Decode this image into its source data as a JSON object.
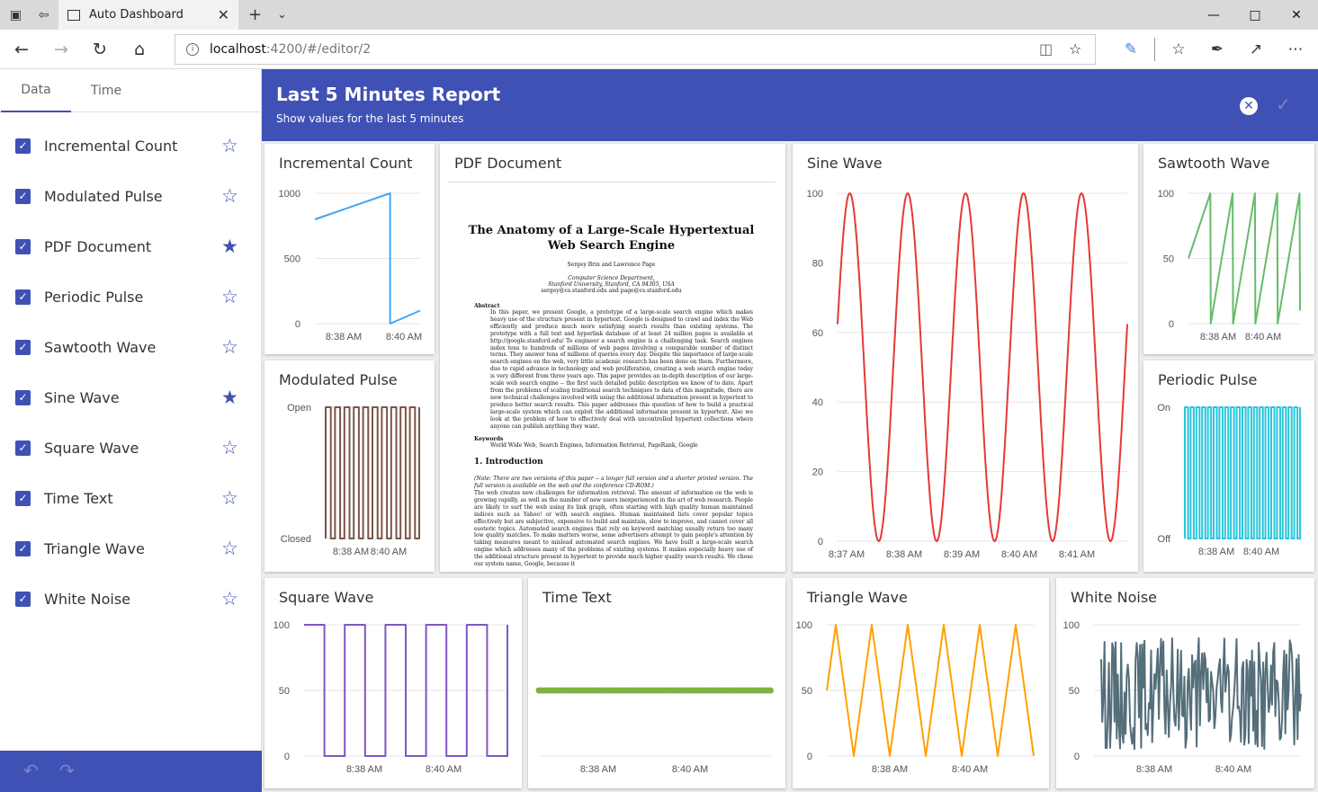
{
  "browser": {
    "tab_title": "Auto Dashboard",
    "url_host": "localhost",
    "url_path": ":4200/#/editor/2"
  },
  "sidebar": {
    "tabs": [
      {
        "label": "Data"
      },
      {
        "label": "Time"
      }
    ],
    "items": [
      {
        "label": "Incremental Count",
        "starred": false,
        "checked": true
      },
      {
        "label": "Modulated Pulse",
        "starred": false,
        "checked": true
      },
      {
        "label": "PDF Document",
        "starred": true,
        "checked": true
      },
      {
        "label": "Periodic Pulse",
        "starred": false,
        "checked": true
      },
      {
        "label": "Sawtooth Wave",
        "starred": false,
        "checked": true
      },
      {
        "label": "Sine Wave",
        "starred": true,
        "checked": true
      },
      {
        "label": "Square Wave",
        "starred": false,
        "checked": true
      },
      {
        "label": "Time Text",
        "starred": false,
        "checked": true
      },
      {
        "label": "Triangle Wave",
        "starred": false,
        "checked": true
      },
      {
        "label": "White Noise",
        "starred": false,
        "checked": true
      }
    ]
  },
  "report": {
    "title": "Last 5 Minutes Report",
    "subtitle": "Show values for the last 5 minutes"
  },
  "cards": {
    "incremental": {
      "title": "Incremental Count"
    },
    "pdf": {
      "title": "PDF Document"
    },
    "sine": {
      "title": "Sine Wave"
    },
    "sawtooth": {
      "title": "Sawtooth Wave"
    },
    "modulated": {
      "title": "Modulated Pulse"
    },
    "periodic": {
      "title": "Periodic Pulse"
    },
    "square": {
      "title": "Square Wave"
    },
    "timetext": {
      "title": "Time Text"
    },
    "triangle": {
      "title": "Triangle Wave"
    },
    "noise": {
      "title": "White Noise"
    }
  },
  "pdf": {
    "title_line1": "The Anatomy of a Large-Scale Hypertextual",
    "title_line2": "Web Search Engine",
    "authors": "Sergey Brin and Lawrence Page",
    "dept": "Computer Science Department,",
    "addr": "Stanford University, Stanford, CA 94305, USA",
    "emails": "sergey@cs.stanford.edu and page@cs.stanford.edu",
    "abstract_head": "Abstract",
    "abstract": "In this paper, we present Google, a prototype of a large-scale search engine which makes heavy use of the structure present in hypertext. Google is designed to crawl and index the Web efficiently and produce much more satisfying search results than existing systems. The prototype with a full text and hyperlink database of at least 24 million pages is available at http://google.stanford.edu/ To engineer a search engine is a challenging task. Search engines index tens to hundreds of millions of web pages involving a comparable number of distinct terms. They answer tens of millions of queries every day. Despite the importance of large-scale search engines on the web, very little academic research has been done on them. Furthermore, due to rapid advance in technology and web proliferation, creating a web search engine today is very different from three years ago. This paper provides an in-depth description of our large-scale web search engine -- the first such detailed public description we know of to date. Apart from the problems of scaling traditional search techniques to data of this magnitude, there are new technical challenges involved with using the additional information present in hypertext to produce better search results. This paper addresses this question of how to build a practical large-scale system which can exploit the additional information present in hypertext. Also we look at the problem of how to effectively deal with uncontrolled hypertext collections where anyone can publish anything they want.",
    "keywords_head": "Keywords",
    "keywords": "World Wide Web, Search Engines, Information Retrieval, PageRank, Google",
    "intro_head": "1. Introduction",
    "intro_note": "(Note: There are two versions of this paper -- a longer full version and a shorter printed version. The full version is available on the web and the conference CD-ROM.)",
    "intro": "The web creates new challenges for information retrieval. The amount of information on the web is growing rapidly, as well as the number of new users inexperienced in the art of web research. People are likely to surf the web using its link graph, often starting with high quality human maintained indices such as Yahoo! or with search engines. Human maintained lists cover popular topics effectively but are subjective, expensive to build and maintain, slow to improve, and cannot cover all esoteric topics. Automated search engines that rely on keyword matching usually return too many low quality matches. To make matters worse, some advertisers attempt to gain people's attention by taking measures meant to mislead automated search engines. We have built a large-scale search engine which addresses many of the problems of existing systems. It makes especially heavy use of the additional structure present in hypertext to provide much higher quality search results. We chose our system name, Google, because it"
  },
  "chart_data": [
    {
      "id": "incremental",
      "type": "line",
      "color": "#42a5f5",
      "ylim": [
        0,
        1000
      ],
      "yticks": [
        "1000",
        "500",
        "0"
      ],
      "xticks": [
        "8:38 AM",
        "8:40 AM"
      ],
      "x": [
        0,
        1,
        1,
        1.4
      ],
      "y": [
        800,
        1000,
        0,
        100
      ]
    },
    {
      "id": "sine",
      "type": "line",
      "color": "#e53935",
      "ylim": [
        0,
        100
      ],
      "yticks": [
        "100",
        "80",
        "60",
        "40",
        "20",
        "0"
      ],
      "xticks": [
        "8:37 AM",
        "8:38 AM",
        "8:39 AM",
        "8:40 AM",
        "8:41 AM"
      ],
      "wave": "sine",
      "cycles": 5
    },
    {
      "id": "sawtooth",
      "type": "line",
      "color": "#66bb6a",
      "ylim": [
        0,
        100
      ],
      "yticks": [
        "100",
        "50",
        "0"
      ],
      "xticks": [
        "8:38 AM",
        "8:40 AM"
      ],
      "wave": "sawtooth",
      "cycles": 5
    },
    {
      "id": "modulated",
      "type": "line",
      "color": "#795548",
      "ylim": [
        0,
        1
      ],
      "yticks": [
        "Open",
        "Closed"
      ],
      "xticks": [
        "8:38 AM",
        "8:40 AM"
      ],
      "wave": "pulse",
      "cycles": 10
    },
    {
      "id": "periodic",
      "type": "line",
      "color": "#26c6da",
      "ylim": [
        0,
        1
      ],
      "yticks": [
        "On",
        "Off"
      ],
      "xticks": [
        "8:38 AM",
        "8:40 AM"
      ],
      "wave": "pulse",
      "cycles": 20
    },
    {
      "id": "square",
      "type": "line",
      "color": "#7e57c2",
      "ylim": [
        0,
        100
      ],
      "yticks": [
        "100",
        "50",
        "0"
      ],
      "xticks": [
        "8:38 AM",
        "8:40 AM"
      ],
      "wave": "square",
      "cycles": 5
    },
    {
      "id": "timetext",
      "type": "scatter",
      "color": "#7cb342",
      "ylim": [
        0,
        100
      ],
      "yticks": [],
      "xticks": [
        "8:38 AM",
        "8:40 AM"
      ],
      "wave": "flat",
      "level": 50
    },
    {
      "id": "triangle",
      "type": "line",
      "color": "#ffa000",
      "ylim": [
        0,
        100
      ],
      "yticks": [
        "100",
        "50",
        "0"
      ],
      "xticks": [
        "8:38 AM",
        "8:40 AM"
      ],
      "wave": "triangle",
      "cycles": 5
    },
    {
      "id": "noise",
      "type": "line",
      "color": "#546e7a",
      "ylim": [
        0,
        100
      ],
      "yticks": [
        "100",
        "50",
        "0"
      ],
      "xticks": [
        "8:38 AM",
        "8:40 AM"
      ],
      "wave": "noise"
    }
  ]
}
